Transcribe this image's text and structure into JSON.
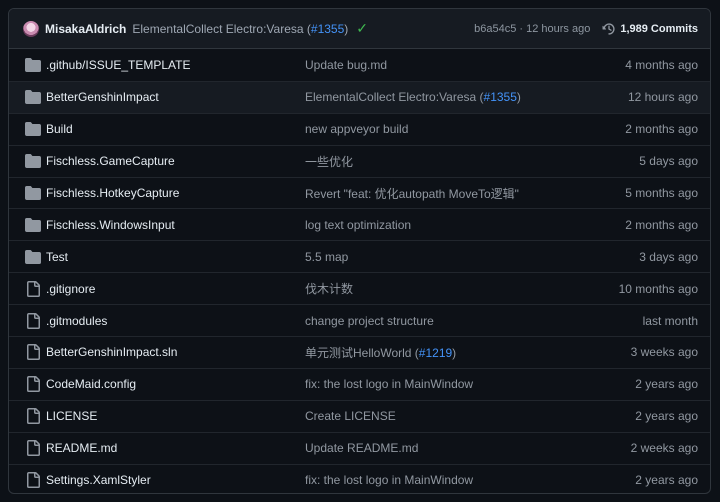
{
  "commit_bar": {
    "author": "MisakaAldrich",
    "message": "ElementalCollect Electro:Varesa (",
    "pr_link": "#1355",
    "message_end": ")",
    "hash_time": "b6a54c5 · 12 hours ago",
    "commits_label": "1,989 Commits"
  },
  "files": [
    {
      "name": ".github/ISSUE_TEMPLATE",
      "type": "folder",
      "commit": "Update bug.md",
      "time": "4 months ago"
    },
    {
      "name": "BetterGenshinImpact",
      "type": "folder",
      "commit": "ElementalCollect Electro:Varesa (",
      "link": "#1355",
      "commit_end": ")",
      "time": "12 hours ago",
      "highlight": true
    },
    {
      "name": "Build",
      "type": "folder",
      "commit": "new appveyor build",
      "time": "2 months ago"
    },
    {
      "name": "Fischless.GameCapture",
      "type": "folder",
      "commit": "一些优化",
      "time": "5 days ago"
    },
    {
      "name": "Fischless.HotkeyCapture",
      "type": "folder",
      "commit": "Revert \"feat: 优化autopath MoveTo逻辑\"",
      "time": "5 months ago"
    },
    {
      "name": "Fischless.WindowsInput",
      "type": "folder",
      "commit": "log text optimization",
      "time": "2 months ago"
    },
    {
      "name": "Test",
      "type": "folder",
      "commit": "5.5 map",
      "time": "3 days ago"
    },
    {
      "name": ".gitignore",
      "type": "file",
      "commit": "伐木计数",
      "time": "10 months ago"
    },
    {
      "name": ".gitmodules",
      "type": "file",
      "commit": "change project structure",
      "time": "last month"
    },
    {
      "name": "BetterGenshinImpact.sln",
      "type": "file",
      "commit": "单元测试HelloWorld (",
      "link": "#1219",
      "commit_end": ")",
      "time": "3 weeks ago"
    },
    {
      "name": "CodeMaid.config",
      "type": "file",
      "commit": "fix: the lost logo in MainWindow",
      "time": "2 years ago"
    },
    {
      "name": "LICENSE",
      "type": "file",
      "commit": "Create LICENSE",
      "time": "2 years ago"
    },
    {
      "name": "README.md",
      "type": "file",
      "commit": "Update README.md",
      "time": "2 weeks ago"
    },
    {
      "name": "Settings.XamlStyler",
      "type": "file",
      "commit": "fix: the lost logo in MainWindow",
      "time": "2 years ago"
    }
  ],
  "colors": {
    "background": "#0d1117",
    "link": "#4493f8",
    "check": "#3fb950",
    "folder_icon": "#9198a1"
  }
}
